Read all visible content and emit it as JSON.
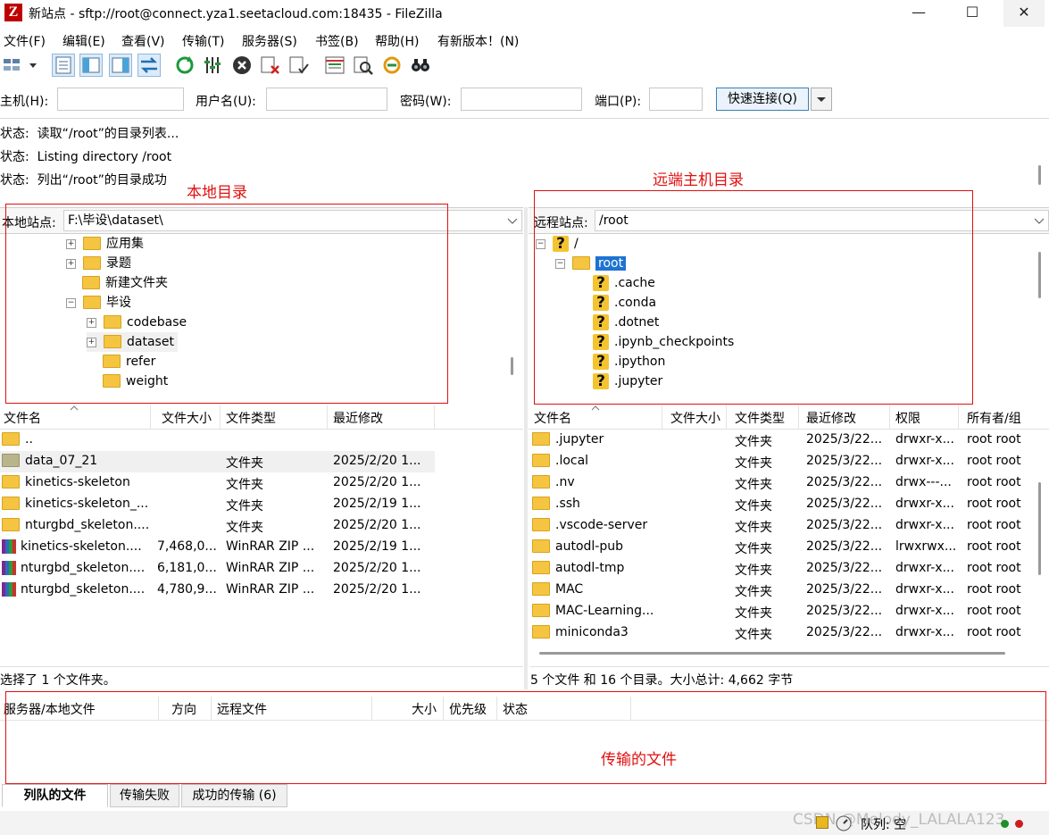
{
  "window": {
    "title": "新站点 - sftp://root@connect.yza1.seetacloud.com:18435 - FileZilla",
    "app_icon": "Z",
    "controls": [
      "—",
      "☐",
      "✕"
    ]
  },
  "menu": [
    "文件(F)",
    "编辑(E)",
    "查看(V)",
    "传输(T)",
    "服务器(S)",
    "书签(B)",
    "帮助(H)",
    "有新版本！(N)"
  ],
  "quickconnect": {
    "host_label": "主机(H):",
    "user_label": "用户名(U):",
    "pass_label": "密码(W):",
    "port_label": "端口(P):",
    "host_value": "",
    "user_value": "",
    "pass_value": "",
    "port_value": "",
    "connect_label": "快速连接(Q)"
  },
  "log": [
    {
      "label": "状态:",
      "text": "读取“/root”的目录列表..."
    },
    {
      "label": "状态:",
      "text": "Listing directory /root"
    },
    {
      "label": "状态:",
      "text": "列出“/root”的目录成功"
    }
  ],
  "annotations": {
    "local": "本地目录",
    "remote": "远端主机目录",
    "transfer": "传输的文件"
  },
  "local": {
    "site_label": "本地站点:",
    "path": "F:\\毕设\\dataset\\",
    "tree": [
      {
        "name": "应用集",
        "expander": "+"
      },
      {
        "name": "录题",
        "expander": "+"
      },
      {
        "name": "新建文件夹",
        "expander": ""
      },
      {
        "name": "毕设",
        "expander": "−"
      },
      {
        "name": "codebase",
        "expander": "+"
      },
      {
        "name": "dataset",
        "expander": "+"
      },
      {
        "name": "refer",
        "expander": ""
      },
      {
        "name": "weight",
        "expander": ""
      }
    ],
    "columns": [
      "文件名",
      "文件大小",
      "文件类型",
      "最近修改"
    ],
    "files": [
      {
        "name": "..",
        "size": "",
        "type": "",
        "modified": ""
      },
      {
        "name": "data_07_21",
        "size": "",
        "type": "文件夹",
        "modified": "2025/2/20 1..."
      },
      {
        "name": "kinetics-skeleton",
        "size": "",
        "type": "文件夹",
        "modified": "2025/2/20 1..."
      },
      {
        "name": "kinetics-skeleton_...",
        "size": "",
        "type": "文件夹",
        "modified": "2025/2/19 1..."
      },
      {
        "name": "nturgbd_skeleton....",
        "size": "",
        "type": "文件夹",
        "modified": "2025/2/20 1..."
      },
      {
        "name": "kinetics-skeleton....",
        "size": "7,468,0...",
        "type": "WinRAR ZIP ...",
        "modified": "2025/2/19 1..."
      },
      {
        "name": "nturgbd_skeleton....",
        "size": "6,181,0...",
        "type": "WinRAR ZIP ...",
        "modified": "2025/2/20 1..."
      },
      {
        "name": "nturgbd_skeleton....",
        "size": "4,780,9...",
        "type": "WinRAR ZIP ...",
        "modified": "2025/2/20 1..."
      }
    ],
    "status": "选择了 1 个文件夹。"
  },
  "remote": {
    "site_label": "远程站点:",
    "path": "/root",
    "tree": [
      {
        "name": "/",
        "icon": "question"
      },
      {
        "name": "root",
        "icon": "folder"
      },
      {
        "name": ".cache",
        "icon": "question"
      },
      {
        "name": ".conda",
        "icon": "question"
      },
      {
        "name": ".dotnet",
        "icon": "question"
      },
      {
        "name": ".ipynb_checkpoints",
        "icon": "question"
      },
      {
        "name": ".ipython",
        "icon": "question"
      },
      {
        "name": ".jupyter",
        "icon": "question"
      }
    ],
    "columns": [
      "文件名",
      "文件大小",
      "文件类型",
      "最近修改",
      "权限",
      "所有者/组"
    ],
    "files": [
      {
        "name": ".jupyter",
        "type": "文件夹",
        "modified": "2025/3/22...",
        "perm": "drwxr-x...",
        "owner": "root root"
      },
      {
        "name": ".local",
        "type": "文件夹",
        "modified": "2025/3/22...",
        "perm": "drwxr-x...",
        "owner": "root root"
      },
      {
        "name": ".nv",
        "type": "文件夹",
        "modified": "2025/3/22...",
        "perm": "drwx---...",
        "owner": "root root"
      },
      {
        "name": ".ssh",
        "type": "文件夹",
        "modified": "2025/3/22...",
        "perm": "drwxr-x...",
        "owner": "root root"
      },
      {
        "name": ".vscode-server",
        "type": "文件夹",
        "modified": "2025/3/22...",
        "perm": "drwxr-x...",
        "owner": "root root"
      },
      {
        "name": "autodl-pub",
        "type": "文件夹",
        "modified": "2025/3/22...",
        "perm": "lrwxrwx...",
        "owner": "root root"
      },
      {
        "name": "autodl-tmp",
        "type": "文件夹",
        "modified": "2025/3/22...",
        "perm": "drwxr-x...",
        "owner": "root root"
      },
      {
        "name": "MAC",
        "type": "文件夹",
        "modified": "2025/3/22...",
        "perm": "drwxr-x...",
        "owner": "root root"
      },
      {
        "name": "MAC-Learning...",
        "type": "文件夹",
        "modified": "2025/3/22...",
        "perm": "drwxr-x...",
        "owner": "root root"
      },
      {
        "name": "miniconda3",
        "type": "文件夹",
        "modified": "2025/3/22...",
        "perm": "drwxr-x...",
        "owner": "root root"
      }
    ],
    "status": "5 个文件 和 16 个目录。大小总计: 4,662 字节"
  },
  "queue": {
    "columns": [
      "服务器/本地文件",
      "方向",
      "远程文件",
      "大小",
      "优先级",
      "状态"
    ],
    "tabs": [
      "列队的文件",
      "传输失败",
      "成功的传输 (6)"
    ],
    "queue_status": "队列: 空"
  },
  "watermark": "CSDN @Melody_LALALA123"
}
